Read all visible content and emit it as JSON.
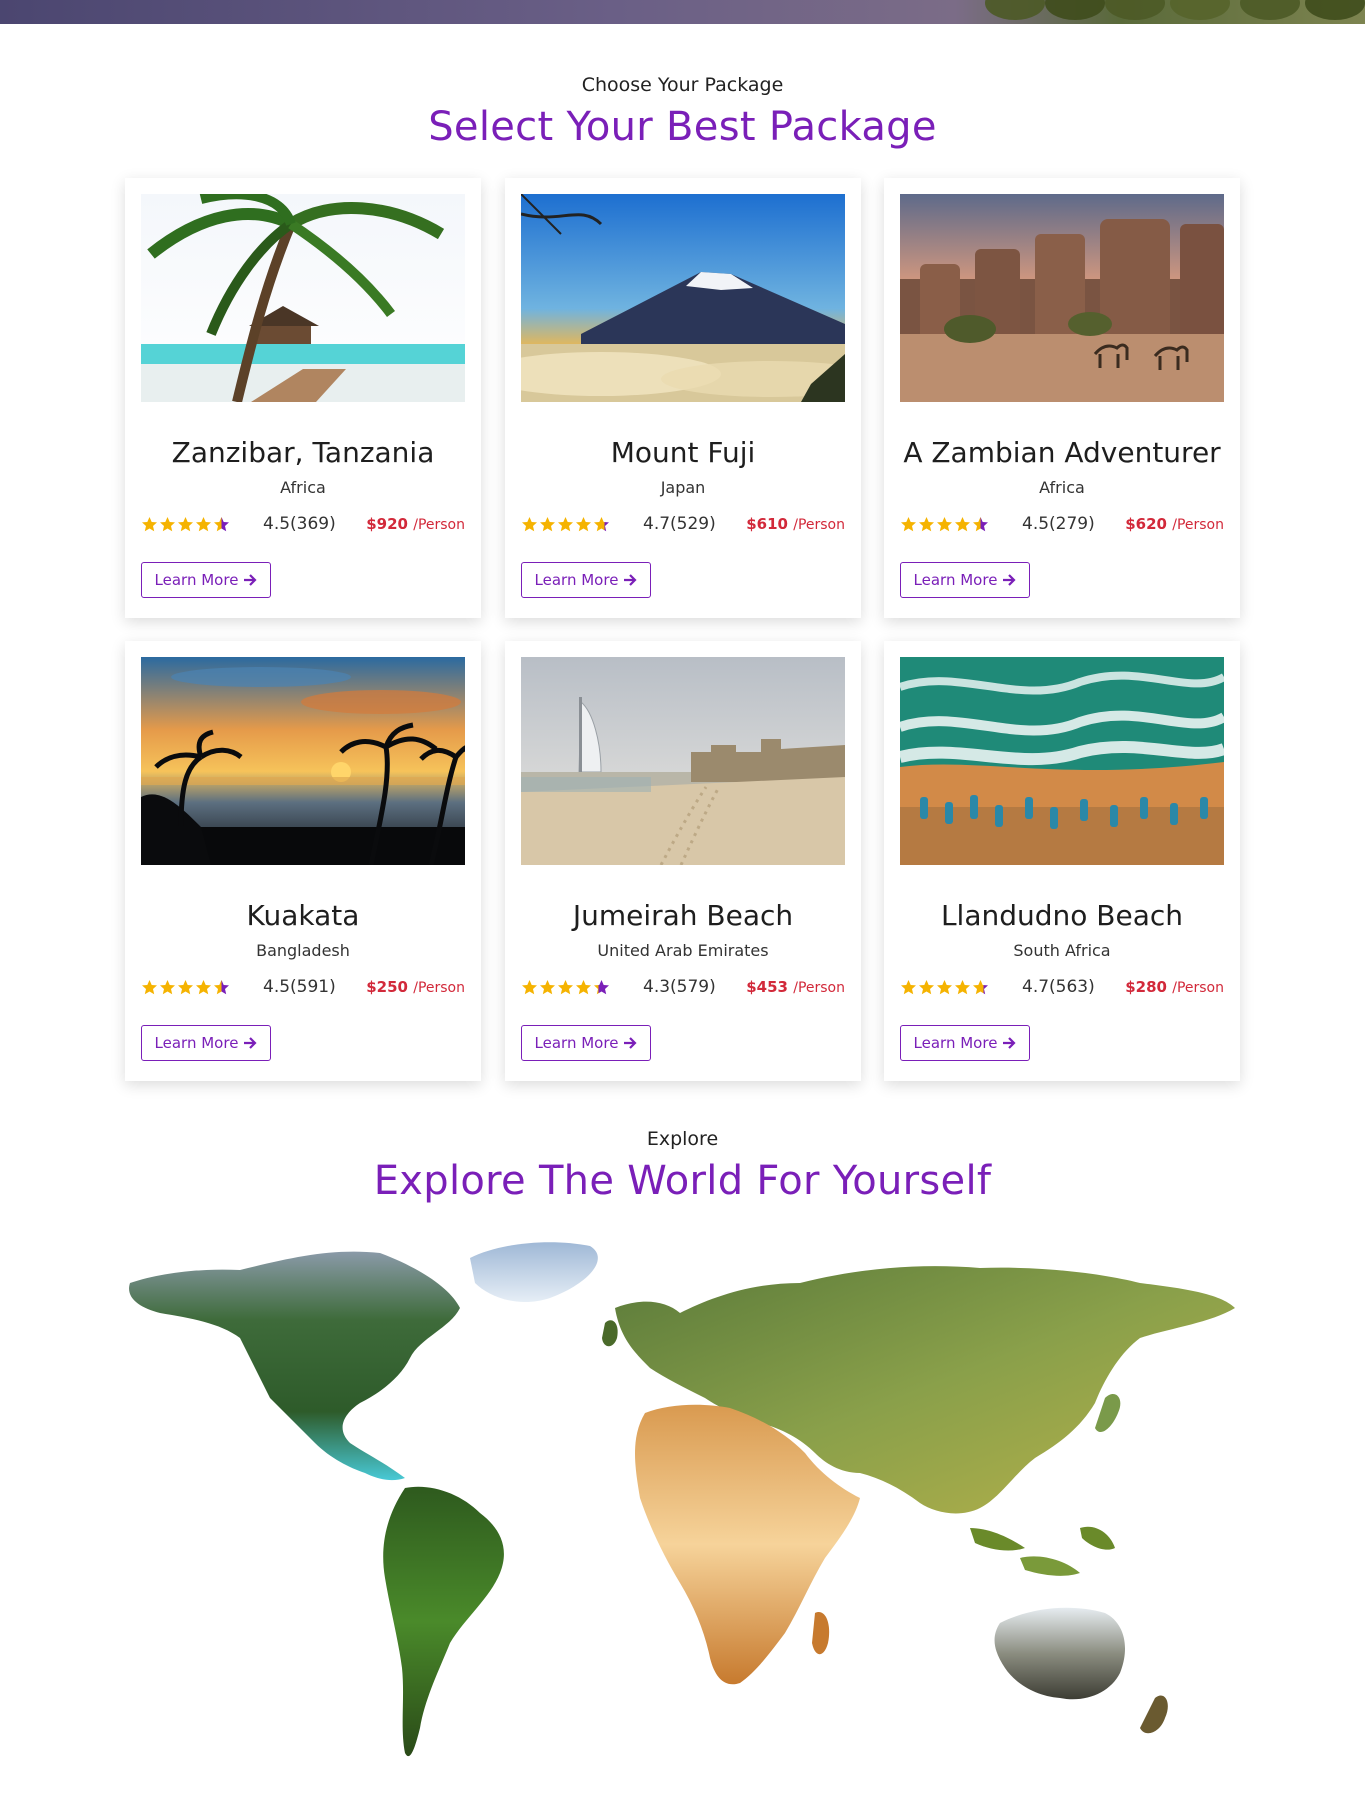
{
  "header": {
    "subtitle": "Choose Your Package",
    "title": "Select Your Best Package"
  },
  "packages": [
    {
      "name": "Zanzibar, Tanzania",
      "location": "Africa",
      "rating": "4.5(369)",
      "stars": 4.5,
      "price": "$920",
      "per": "/Person",
      "button": "Learn More",
      "image": "palm-beach-pier"
    },
    {
      "name": "Mount Fuji",
      "location": "Japan",
      "rating": "4.7(529)",
      "stars": 4.7,
      "price": "$610",
      "per": "/Person",
      "button": "Learn More",
      "image": "snow-mountain-sunset"
    },
    {
      "name": "A Zambian Adventurer",
      "location": "Africa",
      "rating": "4.5(279)",
      "stars": 4.5,
      "price": "$620",
      "per": "/Person",
      "button": "Learn More",
      "image": "desert-fort-camels"
    },
    {
      "name": "Kuakata",
      "location": "Bangladesh",
      "rating": "4.5(591)",
      "stars": 4.5,
      "price": "$250",
      "per": "/Person",
      "button": "Learn More",
      "image": "sunset-beach-palms"
    },
    {
      "name": "Jumeirah Beach",
      "location": "United Arab Emirates",
      "rating": "4.3(579)",
      "stars": 4.3,
      "price": "$453",
      "per": "/Person",
      "button": "Learn More",
      "image": "burj-beach"
    },
    {
      "name": "Llandudno Beach",
      "location": "South Africa",
      "rating": "4.7(563)",
      "stars": 4.7,
      "price": "$280",
      "per": "/Person",
      "button": "Learn More",
      "image": "aerial-beach-boats"
    }
  ],
  "explore": {
    "subtitle": "Explore",
    "title": "Explore The World For Yourself"
  },
  "colors": {
    "accent": "#7a1fb8",
    "price": "#d2293a",
    "star": "#f5b301"
  }
}
